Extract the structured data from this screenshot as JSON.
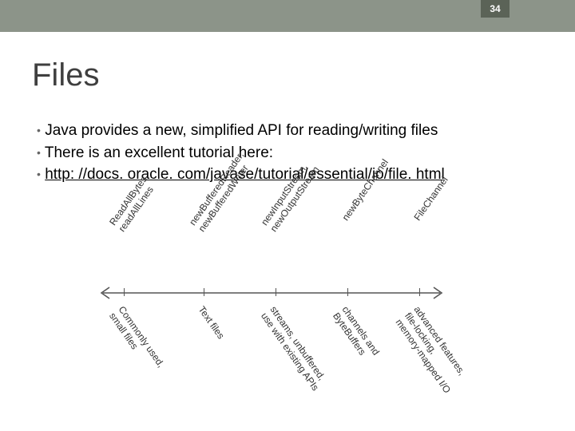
{
  "page_number": "34",
  "title": "Files",
  "bullets": [
    "Java  provides a new, simplified API for reading/writing files",
    "There is an excellent tutorial here:"
  ],
  "link_text": "http: //docs. oracle. com/javase/tutorial/essential/io/file. html",
  "diagram": {
    "tops": [
      "ReadAllBytes\nreadAllLines",
      "newBufferedReader,\nnewBufferedWriter",
      "newInputStream,\nnewOutputStream",
      "newByteChannel",
      "FileChannel"
    ],
    "bottoms": [
      "Commonly used,\nsmall files",
      "Text files",
      "streams, unbuffered,\nuse with existing APIs",
      "channels and\nByteBuffers",
      "advanced features,\nfile-locking,\nmemory-mapped I/O"
    ]
  }
}
